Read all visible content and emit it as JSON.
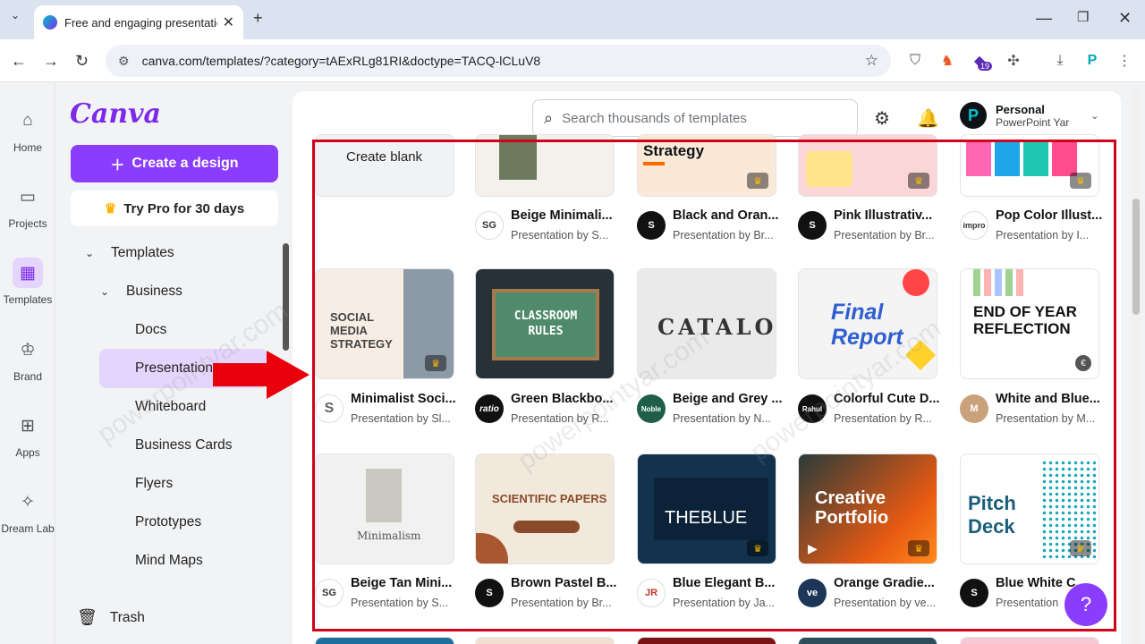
{
  "browser": {
    "tab_title": "Free and engaging presentation",
    "url": "canva.com/templates/?category=tAExRLg81RI&doctype=TACQ-lCLuV8",
    "badge_count": "19"
  },
  "rail": [
    {
      "label": "Home",
      "icon": "home-icon"
    },
    {
      "label": "Projects",
      "icon": "folder-icon"
    },
    {
      "label": "Templates",
      "icon": "templates-icon"
    },
    {
      "label": "Brand",
      "icon": "brand-icon"
    },
    {
      "label": "Apps",
      "icon": "apps-icon"
    },
    {
      "label": "Dream Lab",
      "icon": "dreamlab-icon"
    }
  ],
  "panel": {
    "logo": "Canva",
    "create_label": "Create a design",
    "trypro_label": "Try Pro for 30 days",
    "tree": {
      "templates": "Templates",
      "business": "Business",
      "items": [
        "Docs",
        "Presentations",
        "Whiteboard",
        "Business Cards",
        "Flyers",
        "Prototypes",
        "Mind Maps"
      ]
    },
    "trash": "Trash"
  },
  "header": {
    "search_placeholder": "Search thousands of templates",
    "account_name": "Personal",
    "account_sub": "PowerPoint Yar"
  },
  "row1": [
    {
      "thumb_text": "Create blank"
    },
    {
      "name": "Beige Minimali...",
      "by": "Presentation by S...",
      "avatar": "SG"
    },
    {
      "thumb_text": "Strategy",
      "name": "Black and Oran...",
      "by": "Presentation by Br...",
      "avatar": "S"
    },
    {
      "name": "Pink Illustrativ...",
      "by": "Presentation by Br...",
      "avatar": "S"
    },
    {
      "name": "Pop Color Illust...",
      "by": "Presentation by I...",
      "avatar": "impro"
    }
  ],
  "row2": [
    {
      "thumb_text": "SOCIAL MEDIA STRATEGY",
      "name": "Minimalist Soci...",
      "by": "Presentation by Sl...",
      "avatar": "S"
    },
    {
      "thumb_text": "CLASSROOM RULES",
      "name": "Green Blackbo...",
      "by": "Presentation by R...",
      "avatar": "ratio"
    },
    {
      "thumb_text": "CATALOG",
      "name": "Beige and Grey ...",
      "by": "Presentation by N...",
      "avatar": "Noble"
    },
    {
      "thumb_text": "Final Report",
      "name": "Colorful Cute D...",
      "by": "Presentation by R...",
      "avatar": "Rahul"
    },
    {
      "thumb_text": "END OF YEAR REFLECTION",
      "name": "White and Blue...",
      "by": "Presentation by M...",
      "avatar": "M"
    }
  ],
  "row3": [
    {
      "thumb_text": "Minimalism",
      "name": "Beige Tan Mini...",
      "by": "Presentation by S...",
      "avatar": "SG"
    },
    {
      "thumb_text": "SCIENTIFIC PAPERS",
      "name": "Brown Pastel B...",
      "by": "Presentation by Br...",
      "avatar": "S"
    },
    {
      "thumb_text": "THEBLUE",
      "name": "Blue Elegant B...",
      "by": "Presentation by Ja...",
      "avatar": "JR"
    },
    {
      "thumb_text": "Creative Portfolio",
      "name": "Orange Gradie...",
      "by": "Presentation by ve...",
      "avatar": "ve"
    },
    {
      "thumb_text": "Pitch Deck",
      "name": "Blue White C...",
      "by": "Presentation",
      "avatar": "S"
    }
  ],
  "help_label": "?",
  "watermark": "powerpointyar.com",
  "colors": {
    "accent": "#8b3dff",
    "highlight": "#d0021b"
  }
}
